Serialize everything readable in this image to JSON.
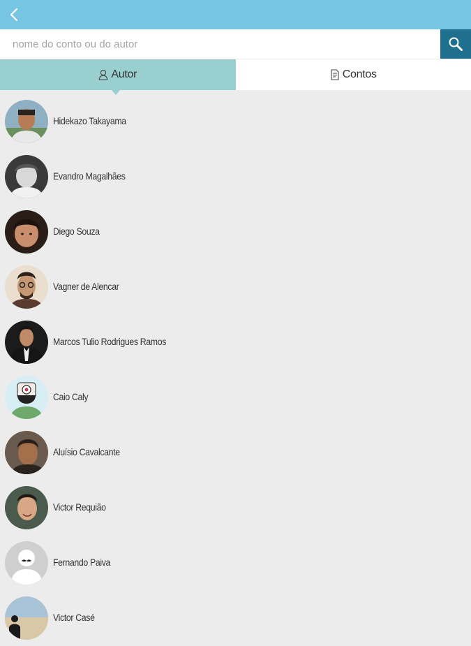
{
  "search": {
    "placeholder": "nome do conto ou do autor"
  },
  "tabs": [
    {
      "label": "Autor",
      "icon": "user-icon",
      "active": true
    },
    {
      "label": "Contos",
      "icon": "document-icon",
      "active": false
    }
  ],
  "authors": [
    {
      "name": "Hidekazo Takayama"
    },
    {
      "name": "Evandro Magalhães"
    },
    {
      "name": "Diego Souza"
    },
    {
      "name": "Vagner de Alencar"
    },
    {
      "name": "Marcos Tulio Rodrigues Ramos"
    },
    {
      "name": "Caio Caly"
    },
    {
      "name": "Aluísio Cavalcante"
    },
    {
      "name": "Victor Requião"
    },
    {
      "name": "Fernando Paiva"
    },
    {
      "name": "Victor Casé"
    }
  ],
  "colors": {
    "topbar": "#76c5e3",
    "search_button": "#1f6f8f",
    "active_tab": "#99cfcf",
    "background": "#ececec"
  }
}
